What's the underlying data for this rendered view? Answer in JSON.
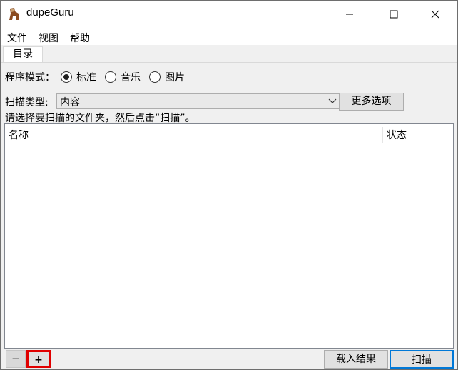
{
  "window": {
    "title": "dupeGuru",
    "controls": {
      "minimize": "minimize-icon",
      "maximize": "maximize-icon",
      "close": "close-icon"
    }
  },
  "menu": {
    "items": [
      "文件",
      "视图",
      "帮助"
    ]
  },
  "tabs": [
    {
      "label": "目录",
      "active": true
    }
  ],
  "mode": {
    "label": "程序模式：",
    "options": [
      "标准",
      "音乐",
      "图片"
    ],
    "selected": "标准"
  },
  "scan": {
    "label": "扫描类型:",
    "value": "内容",
    "more_button": "更多选项"
  },
  "hint": "请选择要扫描的文件夹，然后点击“扫描”。",
  "table": {
    "columns": [
      "名称",
      "状态"
    ],
    "rows": []
  },
  "footer": {
    "remove_label": "−",
    "add_label": "+",
    "load_label": "载入结果",
    "scan_label": "扫描"
  },
  "colors": {
    "highlight": "#e00000",
    "accent": "#0078d7"
  }
}
